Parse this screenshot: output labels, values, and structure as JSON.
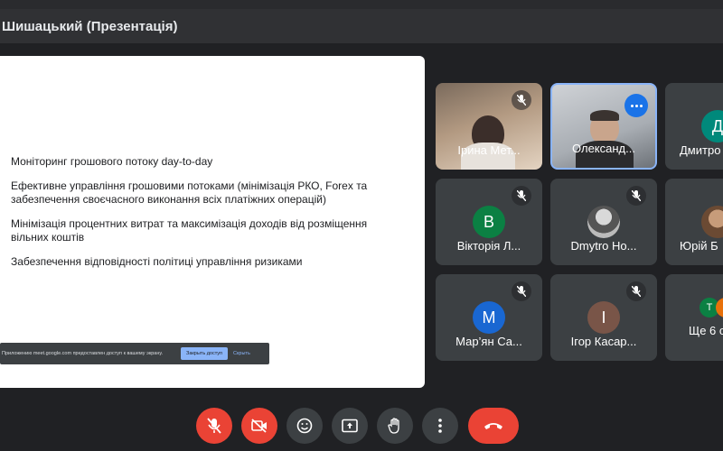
{
  "header": {
    "title": "Шишацький (Презентація)"
  },
  "slide": {
    "bullets": [
      "Моніторинг грошового потоку day-to-day",
      "Ефективне управління грошовими потоками (мінімізація РКО, Forex та забезпечення своєчасного виконання всіх платіжних операцій)",
      "Мінімізація процентних витрат та максимізація доходів від розміщення вільних коштів",
      "Забезпечення відповідності політиці управління ризиками"
    ],
    "share_bar": {
      "message": "Приложению meet.google.com предоставлен доступ к вашему экрану.",
      "stop_label": "Закрыть доступ",
      "hide_label": "Скрыть"
    }
  },
  "participants": [
    {
      "name": "Ірина Мет...",
      "type": "video",
      "muted": true
    },
    {
      "name": "Олександ...",
      "type": "video",
      "muted": false,
      "active": true
    },
    {
      "name": "Дмитро",
      "type": "avatar",
      "initial": "Д",
      "color": "#00897b",
      "muted": false
    },
    {
      "name": "Вікторія Л...",
      "type": "avatar",
      "initial": "В",
      "color": "#0b8043",
      "muted": true
    },
    {
      "name": "Dmytro Ho...",
      "type": "photo",
      "muted": true
    },
    {
      "name": "Юрій Б",
      "type": "photo",
      "muted": false
    },
    {
      "name": "Мар’ян Са...",
      "type": "avatar",
      "initial": "М",
      "color": "#1967d2",
      "muted": true
    },
    {
      "name": "Ігор Касар...",
      "type": "avatar",
      "initial": "І",
      "color": "#795548",
      "muted": true
    },
    {
      "name": "Ще 6 о",
      "type": "more",
      "initials": [
        "Т",
        ""
      ]
    }
  ],
  "colors": {
    "hangup": "#ea4335",
    "active_border": "#8ab4f8",
    "tile_bg": "#3c4043"
  },
  "controls": [
    "mic-off-icon",
    "camera-off-icon",
    "emoji-icon",
    "present-icon",
    "raise-hand-icon",
    "more-vert-icon",
    "hangup-icon"
  ]
}
